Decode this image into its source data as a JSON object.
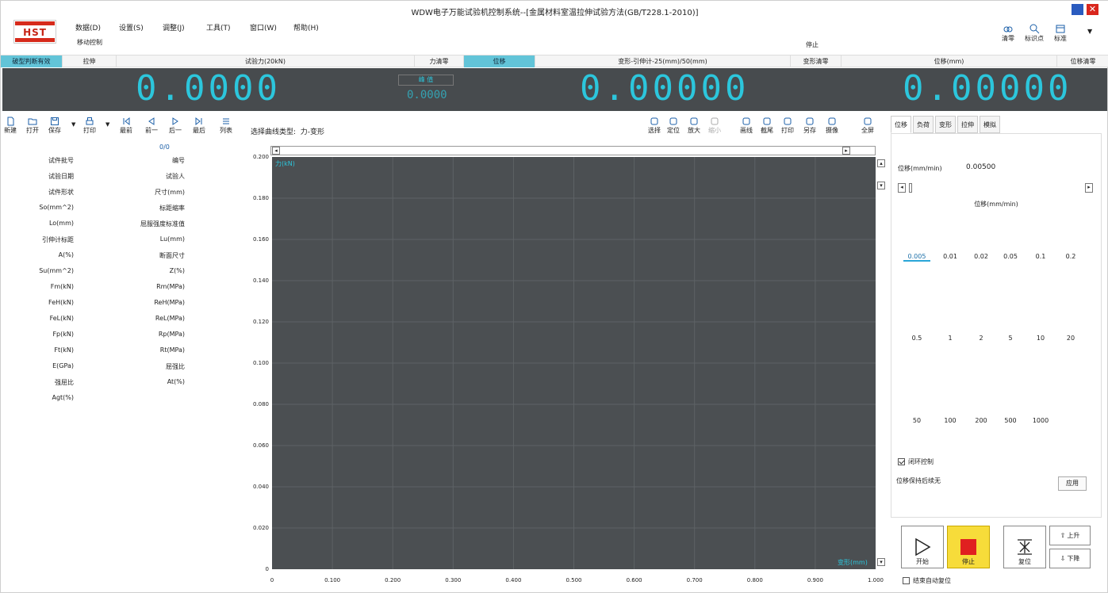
{
  "window": {
    "title": "WDW电子万能试验机控制系统--[金属材料室温拉伸试验方法(GB/T228.1-2010)]"
  },
  "logo": "HST",
  "menu": [
    "数据(D)",
    "设置(S)",
    "调整(J)",
    "工具(T)",
    "窗口(W)",
    "帮助(H)"
  ],
  "submenu": "移动控制",
  "status": "停止",
  "top_tools": [
    {
      "label": "清零",
      "icon": "zero-icon"
    },
    {
      "label": "标识点",
      "icon": "marker-icon"
    },
    {
      "label": "标准",
      "icon": "standard-icon"
    }
  ],
  "header": {
    "cols": [
      "破型判断有效",
      "拉伸",
      "试验力(20kN)",
      "力清零",
      "位移",
      "变形-引伸计-25(mm)/50(mm)",
      "变形清零",
      "位移(mm)",
      "位移清零"
    ]
  },
  "display": {
    "force": "0.0000",
    "peak_label": "峰 值",
    "peak_value": "0.0000",
    "deform": "0.00000",
    "displacement": "0.00000"
  },
  "left_toolbar": [
    "新建",
    "打开",
    "保存",
    "打印",
    "最前",
    "前一",
    "后一",
    "最后",
    "列表"
  ],
  "record_index": "0/0",
  "fields_left": [
    "试件批号",
    "试验日期",
    "试件形状",
    "So(mm^2)",
    "Lo(mm)",
    "引伸计标距",
    "A(%)",
    "Su(mm^2)",
    "Fm(kN)",
    "FeH(kN)",
    "FeL(kN)",
    "Fp(kN)",
    "Ft(kN)",
    "E(GPa)",
    "强屈比",
    "Agt(%)"
  ],
  "fields_right": [
    "编号",
    "试验人",
    "尺寸(mm)",
    "标距缩率",
    "屈服强度标准值",
    "Lu(mm)",
    "断面尺寸",
    "Z(%)",
    "Rm(MPa)",
    "ReH(MPa)",
    "ReL(MPa)",
    "Rp(MPa)",
    "Rt(MPa)",
    "屈强比",
    "At(%)"
  ],
  "chart_toolbar": [
    "选择",
    "定位",
    "放大",
    "缩小",
    "画线",
    "截尾",
    "打印",
    "另存",
    "摄像",
    "全屏"
  ],
  "chart": {
    "curve_type_label": "选择曲线类型:",
    "curve_type_value": "力-变形",
    "y_series_label": "力(kN)",
    "x_series_label": "变形(mm)"
  },
  "chart_data": {
    "type": "line",
    "xlabel": "变形(mm)",
    "ylabel": "力(kN)",
    "xlim": [
      0,
      1.0
    ],
    "ylim": [
      0,
      0.2
    ],
    "x_ticks": [
      "0",
      "0.100",
      "0.200",
      "0.300",
      "0.400",
      "0.500",
      "0.600",
      "0.700",
      "0.800",
      "0.900",
      "1.000"
    ],
    "y_ticks": [
      "0.200",
      "0.180",
      "0.160",
      "0.140",
      "0.120",
      "0.100",
      "0.080",
      "0.060",
      "0.040",
      "0.020",
      "0"
    ],
    "grid": true,
    "series": []
  },
  "right_tabs": [
    "位移",
    "负荷",
    "变形",
    "拉伸",
    "模拟"
  ],
  "speed": {
    "label": "位移(mm/min)",
    "value": "0.00500",
    "unit_label": "位移(mm/min)",
    "options": [
      "0.005",
      "0.01",
      "0.02",
      "0.05",
      "0.1",
      "0.2",
      "0.5",
      "1",
      "2",
      "5",
      "10",
      "20",
      "50",
      "100",
      "200",
      "500",
      "1000"
    ]
  },
  "closed_loop": "闭环控制",
  "closed_loop_checked": true,
  "end_label": "位移保持后续无",
  "apply": "应用",
  "buttons": {
    "start": "开始",
    "stop": "停止",
    "reset": "复位",
    "up": "上升",
    "down": "下降"
  },
  "auto_reset": "结束自动复位",
  "colors": {
    "accent": "#2cc6dc",
    "lcd_bg": "#474b4e",
    "plot_bg": "#4b4f52",
    "stop": "#e02020",
    "stop_frame": "#f7dc3a"
  }
}
